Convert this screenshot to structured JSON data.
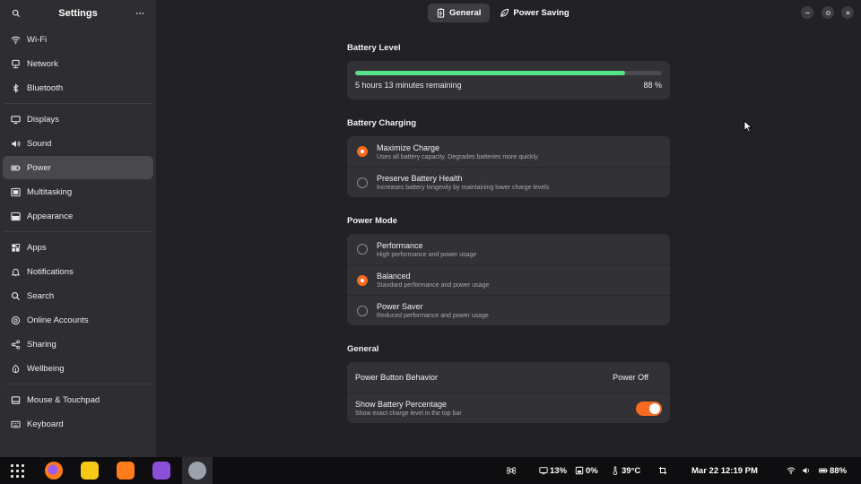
{
  "sidebar": {
    "title": "Settings",
    "items": [
      {
        "label": "Wi-Fi",
        "icon": "wifi-icon"
      },
      {
        "label": "Network",
        "icon": "network-icon"
      },
      {
        "label": "Bluetooth",
        "icon": "bluetooth-icon"
      },
      {
        "label": "Displays",
        "icon": "display-icon"
      },
      {
        "label": "Sound",
        "icon": "speaker-icon"
      },
      {
        "label": "Power",
        "icon": "power-icon",
        "active": true
      },
      {
        "label": "Multitasking",
        "icon": "multitasking-icon"
      },
      {
        "label": "Appearance",
        "icon": "appearance-icon"
      },
      {
        "label": "Apps",
        "icon": "apps-icon"
      },
      {
        "label": "Notifications",
        "icon": "bell-icon"
      },
      {
        "label": "Search",
        "icon": "search-icon"
      },
      {
        "label": "Online Accounts",
        "icon": "at-icon"
      },
      {
        "label": "Sharing",
        "icon": "share-icon"
      },
      {
        "label": "Wellbeing",
        "icon": "wellbeing-icon"
      },
      {
        "label": "Mouse & Touchpad",
        "icon": "mouse-icon"
      },
      {
        "label": "Keyboard",
        "icon": "keyboard-icon"
      }
    ]
  },
  "tabs": [
    {
      "label": "General",
      "icon": "battery-icon",
      "active": true
    },
    {
      "label": "Power Saving",
      "icon": "leaf-icon",
      "active": false
    }
  ],
  "battery_level": {
    "title": "Battery Level",
    "remaining": "5 hours 13 minutes remaining",
    "percent_label": "88 %",
    "fill_percent": 88,
    "fill_color": "#57e389"
  },
  "battery_charging": {
    "title": "Battery Charging",
    "options": [
      {
        "title": "Maximize Charge",
        "subtitle": "Uses all battery capacity. Degrades batteries more quickly.",
        "selected": true
      },
      {
        "title": "Preserve Battery Health",
        "subtitle": "Increases battery longevity by maintaining lower charge levels",
        "selected": false
      }
    ]
  },
  "power_mode": {
    "title": "Power Mode",
    "options": [
      {
        "title": "Performance",
        "subtitle": "High performance and power usage",
        "selected": false
      },
      {
        "title": "Balanced",
        "subtitle": "Standard performance and power usage",
        "selected": true
      },
      {
        "title": "Power Saver",
        "subtitle": "Reduced performance and power usage",
        "selected": false
      }
    ]
  },
  "general": {
    "title": "General",
    "power_button_label": "Power Button Behavior",
    "power_button_value": "Power Off",
    "show_pct_label": "Show Battery Percentage",
    "show_pct_sub": "Show exact charge level in the top bar",
    "show_pct_enabled": true
  },
  "accent_color": "#f66a22",
  "taskbar": {
    "cpu": "13%",
    "disk": "0%",
    "temp": "39°C",
    "clock": "Mar 22  12:19 PM",
    "battery": "88%"
  }
}
